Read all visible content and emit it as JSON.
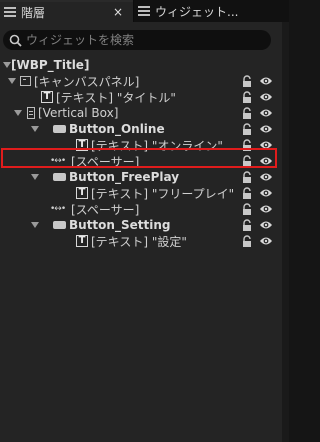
{
  "tabs": [
    {
      "label": "階層",
      "close": "×",
      "active": true
    },
    {
      "label": "ウィジェット...",
      "active": false
    }
  ],
  "search": {
    "placeholder": "ウィジェットを検索"
  },
  "tree": [
    {
      "label": "[WBP_Title]",
      "icon": "none",
      "bold": true,
      "expanded": true
    },
    {
      "label": "[キャンバスパネル]",
      "icon": "canvas-panel-icon",
      "expanded": true
    },
    {
      "label": "[テキスト] \"タイトル\"",
      "icon": "text-widget-icon"
    },
    {
      "label": "[Vertical Box]",
      "icon": "vertical-box-icon",
      "expanded": true
    },
    {
      "label": "Button_Online",
      "icon": "button-widget-icon",
      "bold": true,
      "expanded": true
    },
    {
      "label": "[テキスト] \"オンライン\"",
      "icon": "text-widget-icon"
    },
    {
      "label": "[スペーサー]",
      "icon": "spacer-icon",
      "highlighted": true
    },
    {
      "label": "Button_FreePlay",
      "icon": "button-widget-icon",
      "bold": true,
      "expanded": true
    },
    {
      "label": "[テキスト] \"フリープレイ\"",
      "icon": "text-widget-icon"
    },
    {
      "label": "[スペーサー]",
      "icon": "spacer-icon"
    },
    {
      "label": "Button_Setting",
      "icon": "button-widget-icon",
      "bold": true,
      "expanded": true
    },
    {
      "label": "[テキスト] \"設定\"",
      "icon": "text-widget-icon"
    }
  ],
  "colors": {
    "highlight": "#e01c1c",
    "panel": "#242424",
    "background": "#151515"
  }
}
